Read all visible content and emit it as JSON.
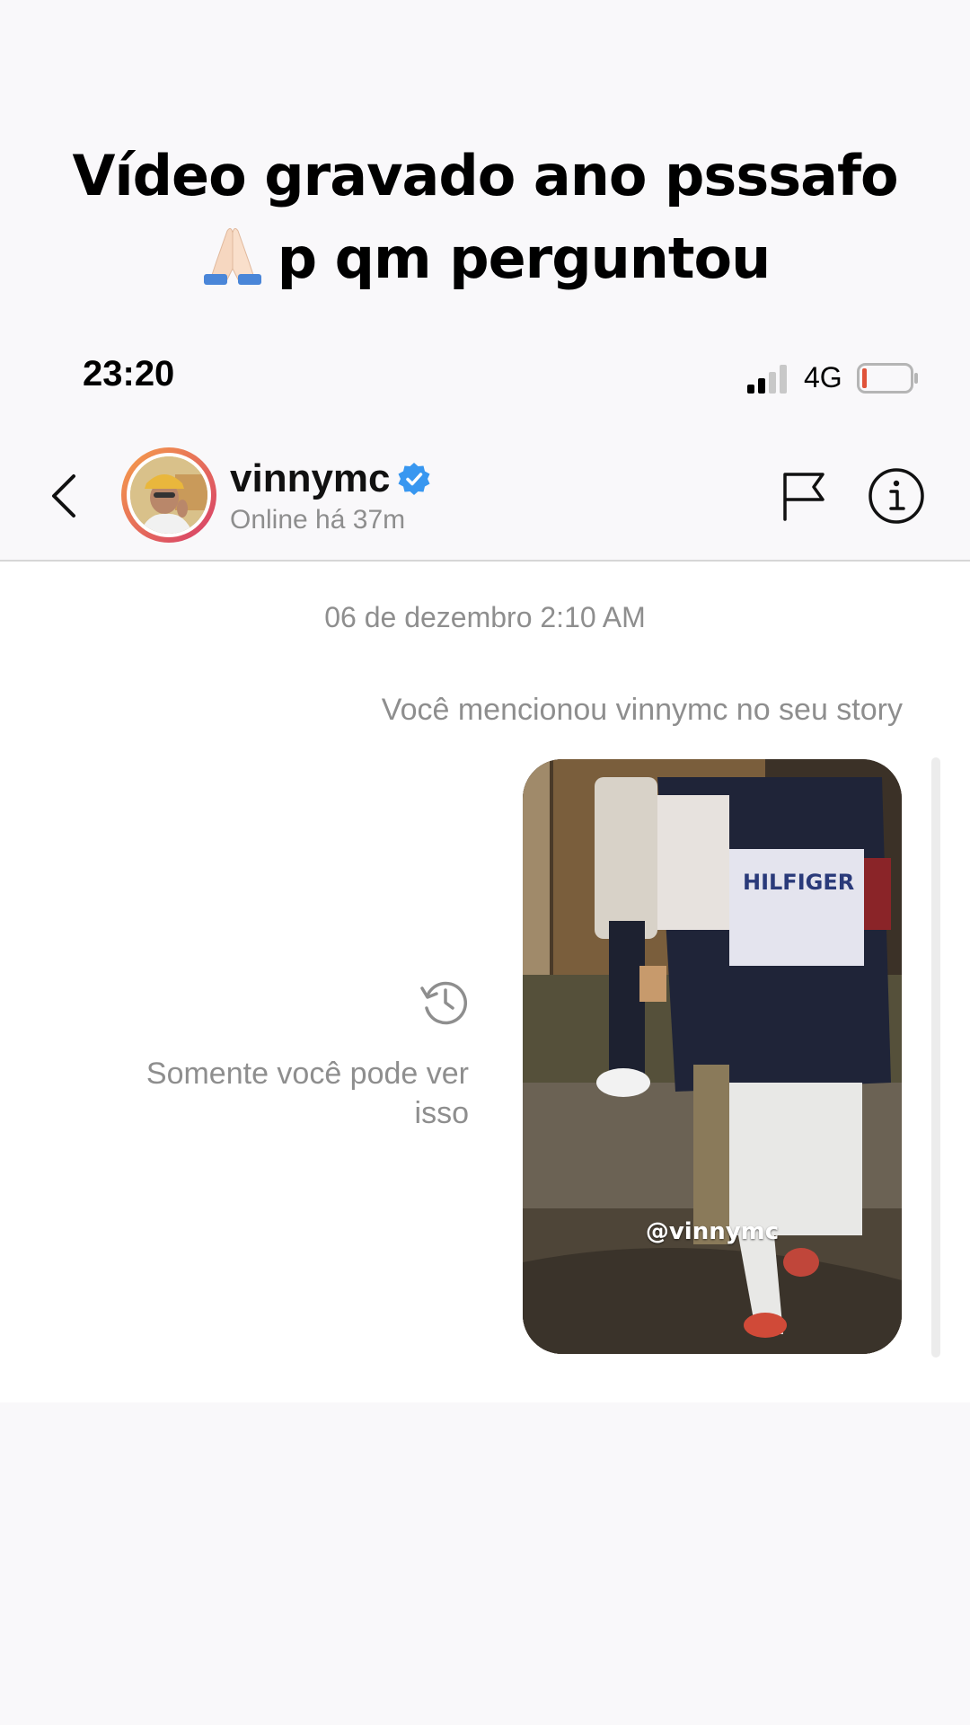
{
  "caption": {
    "line1": "Vídeo gravado ano psssafo",
    "line2_emoji": "folded-hands-emoji",
    "line2": "p qm perguntou"
  },
  "status_bar": {
    "time": "23:20",
    "network": "4G",
    "battery_color": "#e0533a"
  },
  "header": {
    "username": "vinnymc",
    "online_status": "Online há 37m",
    "verified_color": "#3897f0"
  },
  "chat": {
    "date": "06 de dezembro 2:10 AM",
    "mention_notice": "Você mencionou vinnymc no seu story",
    "private_note": "Somente você pode ver isso",
    "story_tag": "@vinnymc"
  }
}
